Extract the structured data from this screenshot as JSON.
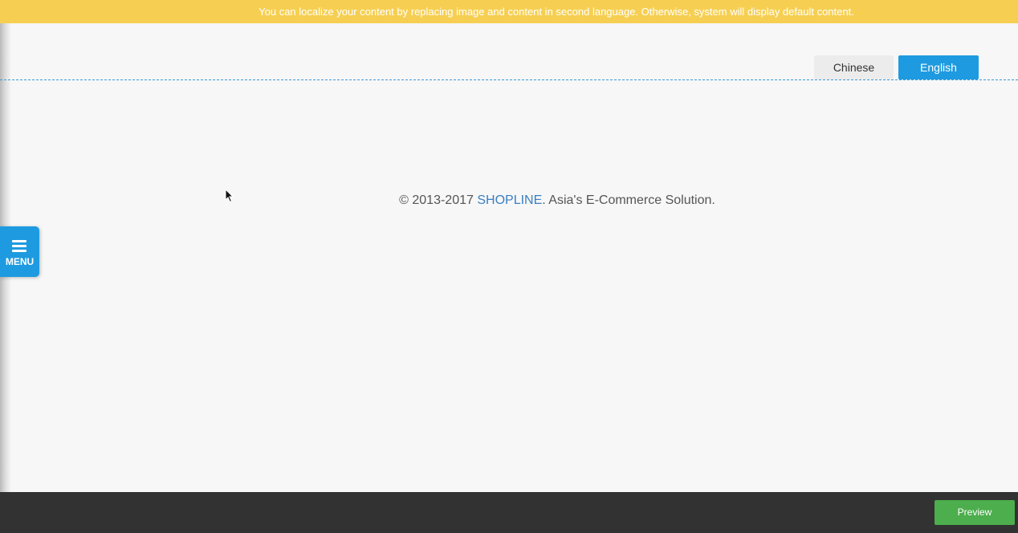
{
  "notice_bar": {
    "text": "You can localize your content by replacing image and content in second language. Otherwise, system will display default content."
  },
  "language_switcher": {
    "options": [
      {
        "label": "Chinese",
        "active": false
      },
      {
        "label": "English",
        "active": true
      }
    ]
  },
  "footer": {
    "copyright_prefix": "© 2013-2017 ",
    "brand": "SHOPLINE",
    "copyright_suffix": ". Asia's E-Commerce Solution."
  },
  "side_menu": {
    "label": "MENU",
    "icon": "hamburger-menu-icon"
  },
  "bottom_toolbar": {
    "preview_label": "Preview"
  },
  "colors": {
    "notice_bg": "#f6cf52",
    "accent_blue": "#1e9be0",
    "brand_link": "#3a7fc1",
    "preview_green": "#4cae4c",
    "toolbar_bg": "#323232",
    "page_bg": "#f7f7f7"
  }
}
